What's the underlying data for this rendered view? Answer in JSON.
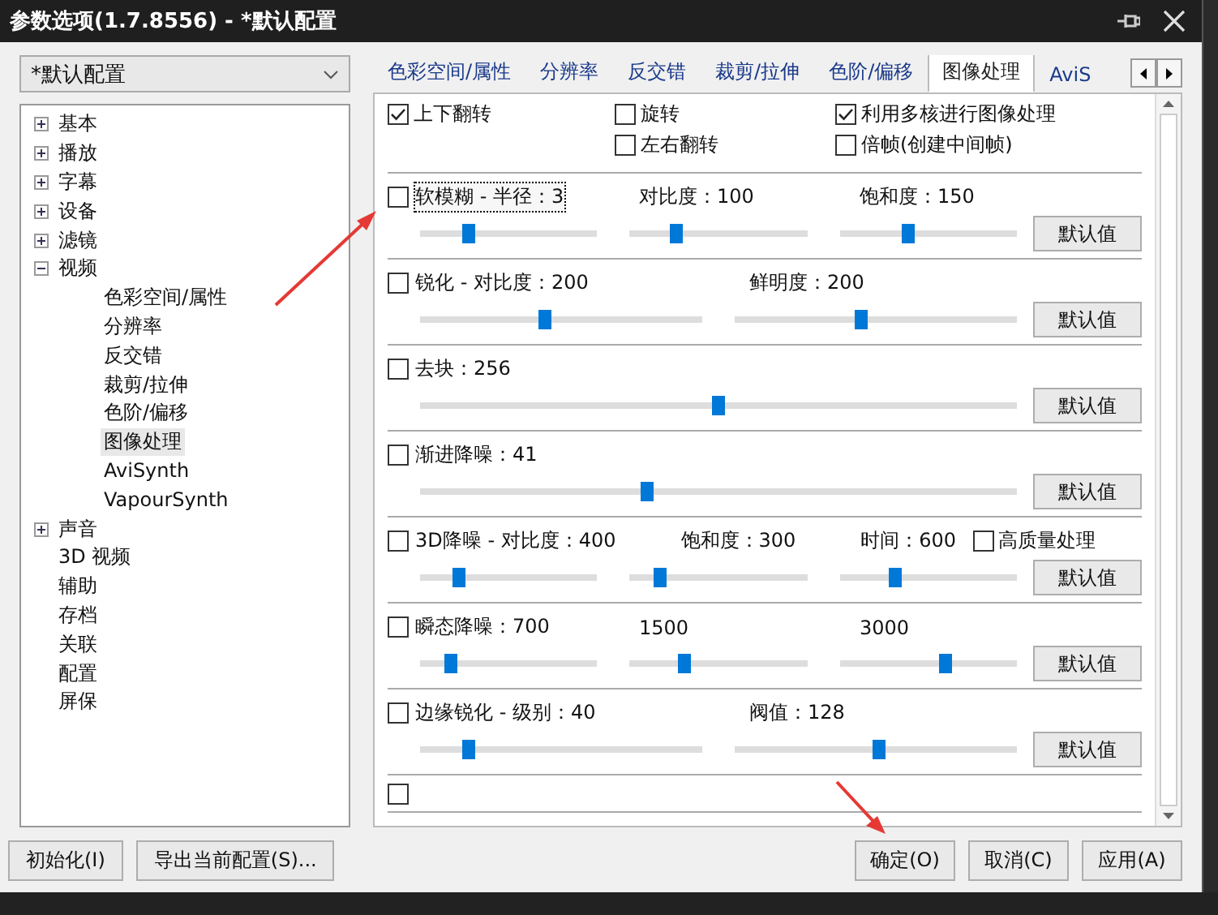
{
  "window": {
    "title": "参数选项(1.7.8556) - *默认配置"
  },
  "profile_select": {
    "value": "*默认配置"
  },
  "tree": [
    {
      "label": "基本",
      "expanded": false,
      "selected": false
    },
    {
      "label": "播放",
      "expanded": false,
      "selected": false
    },
    {
      "label": "字幕",
      "expanded": false,
      "selected": false
    },
    {
      "label": "设备",
      "expanded": false,
      "selected": false
    },
    {
      "label": "滤镜",
      "expanded": false,
      "selected": false
    },
    {
      "label": "视频",
      "expanded": true,
      "selected": false,
      "children": [
        {
          "label": "色彩空间/属性",
          "selected": false
        },
        {
          "label": "分辨率",
          "selected": false
        },
        {
          "label": "反交错",
          "selected": false
        },
        {
          "label": "裁剪/拉伸",
          "selected": false
        },
        {
          "label": "色阶/偏移",
          "selected": false
        },
        {
          "label": "图像处理",
          "selected": true
        },
        {
          "label": "AviSynth",
          "selected": false
        },
        {
          "label": "VapourSynth",
          "selected": false
        }
      ]
    },
    {
      "label": "声音",
      "expanded": false,
      "selected": false
    },
    {
      "label": "3D 视频",
      "selected": false
    },
    {
      "label": "辅助",
      "selected": false
    },
    {
      "label": "存档",
      "selected": false
    },
    {
      "label": "关联",
      "selected": false
    },
    {
      "label": "配置",
      "selected": false
    },
    {
      "label": "屏保",
      "selected": false
    }
  ],
  "tabs": [
    {
      "label": "色彩空间/属性",
      "selected": false
    },
    {
      "label": "分辨率",
      "selected": false
    },
    {
      "label": "反交错",
      "selected": false
    },
    {
      "label": "裁剪/拉伸",
      "selected": false
    },
    {
      "label": "色阶/偏移",
      "selected": false
    },
    {
      "label": "图像处理",
      "selected": true
    },
    {
      "label": "AviS",
      "selected": false
    }
  ],
  "options": [
    {
      "label": "上下翻转",
      "checked": true
    },
    {
      "label": "旋转",
      "checked": false
    },
    {
      "label": "利用多核进行图像处理",
      "checked": true
    },
    {
      "label": "左右翻转",
      "checked": false
    },
    {
      "label": "倍帧(创建中间帧)",
      "checked": false
    }
  ],
  "filters": [
    {
      "checked": false,
      "focused": true,
      "button": "默认值",
      "params": [
        {
          "label": "软模糊 - 半径：3",
          "level": 0.27
        },
        {
          "label": "对比度：100",
          "level": 0.26
        },
        {
          "label": "饱和度：150",
          "level": 0.39
        }
      ]
    },
    {
      "checked": false,
      "button": "默认值",
      "params": [
        {
          "label": "锐化 - 对比度：200",
          "level": 0.44
        },
        {
          "label": "鲜明度：200",
          "level": 0.45
        }
      ]
    },
    {
      "checked": false,
      "button": "默认值",
      "params": [
        {
          "label": "去块：256",
          "level": 0.5
        }
      ]
    },
    {
      "checked": false,
      "button": "默认值",
      "params": [
        {
          "label": "渐进降噪：41",
          "level": 0.38
        }
      ]
    },
    {
      "checked": false,
      "button": "默认值",
      "params": [
        {
          "label": "3D降噪 - 对比度：400",
          "level": 0.22
        },
        {
          "label": "饱和度：300",
          "level": 0.17
        },
        {
          "label": "时间：600",
          "level": 0.31
        }
      ],
      "extra": {
        "label": "高质量处理",
        "checked": false
      }
    },
    {
      "checked": false,
      "button": "默认值",
      "params": [
        {
          "label": "瞬态降噪：700",
          "level": 0.17
        },
        {
          "label": "1500",
          "level": 0.31
        },
        {
          "label": "3000",
          "level": 0.6
        }
      ]
    },
    {
      "checked": false,
      "button": "默认值",
      "params": [
        {
          "label": "边缘锐化 - 级别：40",
          "level": 0.17
        },
        {
          "label": "阀值：128",
          "level": 0.51
        }
      ]
    },
    {
      "checked": false
    }
  ],
  "footer_buttons": {
    "left": [
      "初始化(I)",
      "导出当前配置(S)..."
    ],
    "right": [
      "确定(O)",
      "取消(C)",
      "应用(A)"
    ]
  }
}
